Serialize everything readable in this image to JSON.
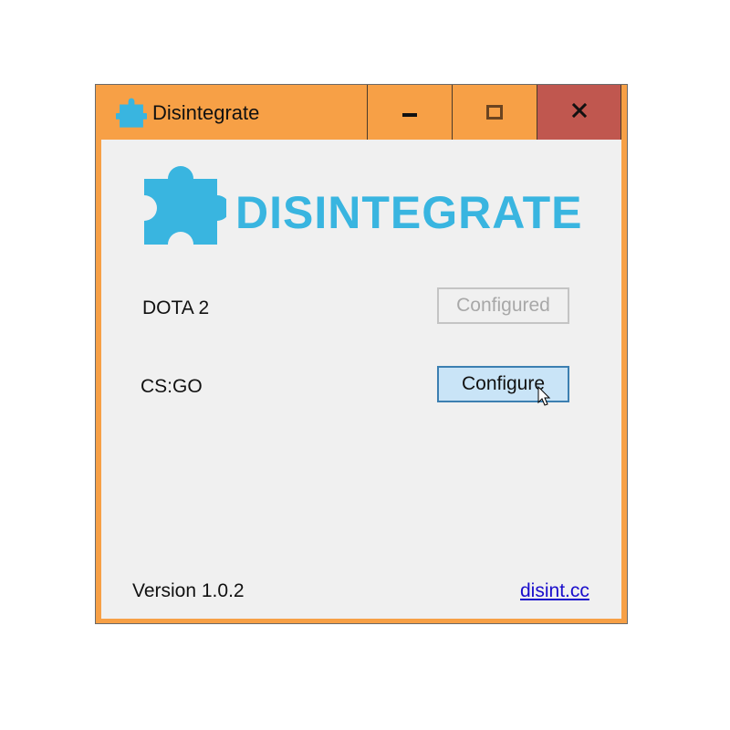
{
  "window": {
    "title": "Disintegrate",
    "app_icon": "puzzle-icon",
    "controls": {
      "minimize_icon": "minimize-icon",
      "maximize_icon": "maximize-icon",
      "close_icon": "close-icon"
    }
  },
  "logo": {
    "text": "DISINTEGRATE",
    "icon": "puzzle-icon",
    "color": "#39b5e0"
  },
  "games": [
    {
      "label": "DOTA 2",
      "button_label": "Configured",
      "enabled": false
    },
    {
      "label": "CS:GO",
      "button_label": "Configure",
      "enabled": true
    }
  ],
  "footer": {
    "version": "Version 1.0.2",
    "link": "disint.cc"
  },
  "colors": {
    "accent_frame": "#f7a046",
    "close_button": "#c0574f",
    "client_background": "#f0f0f0",
    "button_hover": "#c9e4f7",
    "link": "#1a0dcc"
  }
}
